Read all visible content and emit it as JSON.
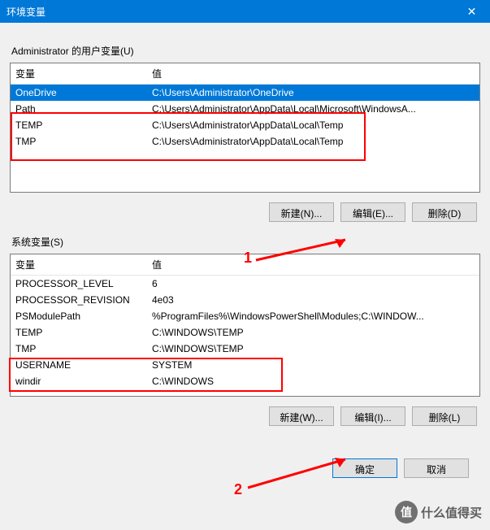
{
  "titlebar": {
    "title": "环境变量",
    "close": "✕"
  },
  "user_section": {
    "label": "Administrator 的用户变量(U)",
    "headers": {
      "name": "变量",
      "value": "值"
    },
    "rows": [
      {
        "name": "OneDrive",
        "value": "C:\\Users\\Administrator\\OneDrive",
        "selected": true
      },
      {
        "name": "Path",
        "value": "C:\\Users\\Administrator\\AppData\\Local\\Microsoft\\WindowsA..."
      },
      {
        "name": "TEMP",
        "value": "C:\\Users\\Administrator\\AppData\\Local\\Temp"
      },
      {
        "name": "TMP",
        "value": "C:\\Users\\Administrator\\AppData\\Local\\Temp"
      }
    ],
    "buttons": {
      "new": "新建(N)...",
      "edit": "编辑(E)...",
      "delete": "删除(D)"
    }
  },
  "system_section": {
    "label": "系统变量(S)",
    "headers": {
      "name": "变量",
      "value": "值"
    },
    "rows": [
      {
        "name": "PROCESSOR_LEVEL",
        "value": "6"
      },
      {
        "name": "PROCESSOR_REVISION",
        "value": "4e03"
      },
      {
        "name": "PSModulePath",
        "value": "%ProgramFiles%\\WindowsPowerShell\\Modules;C:\\WINDOW..."
      },
      {
        "name": "TEMP",
        "value": "C:\\WINDOWS\\TEMP"
      },
      {
        "name": "TMP",
        "value": "C:\\WINDOWS\\TEMP"
      },
      {
        "name": "USERNAME",
        "value": "SYSTEM"
      },
      {
        "name": "windir",
        "value": "C:\\WINDOWS"
      }
    ],
    "buttons": {
      "new": "新建(W)...",
      "edit": "编辑(I)...",
      "delete": "删除(L)"
    }
  },
  "dialog_buttons": {
    "ok": "确定",
    "cancel": "取消"
  },
  "annotations": {
    "num1": "1",
    "num2": "2"
  },
  "watermark": {
    "icon": "值",
    "text": "什么值得买"
  }
}
